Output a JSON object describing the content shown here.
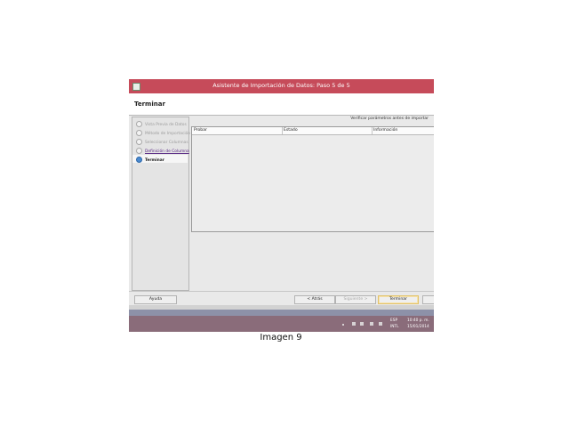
{
  "window": {
    "title": "Asistente de Importación de Datos: Paso 5 de 5"
  },
  "header": {
    "title": "Terminar"
  },
  "steps": [
    {
      "label": "Vista Previa de Datos",
      "state": "done"
    },
    {
      "label": "Método de Importación",
      "state": "done"
    },
    {
      "label": "Seleccionar Columnas",
      "state": "done"
    },
    {
      "label": "Definición de Columna",
      "state": "link"
    },
    {
      "label": "Terminar",
      "state": "current"
    }
  ],
  "main": {
    "verify_label": "Verificar parámetros antes de importar",
    "columns": [
      "Probar",
      "Estado",
      "Información"
    ]
  },
  "buttons": {
    "help": "Ayuda",
    "back": "< Atrás",
    "next": "Siguiente >",
    "finish": "Terminar"
  },
  "taskbar": {
    "lang_top": "ESP",
    "lang_bottom": "INTL",
    "time": "10:40 p. m.",
    "date": "15/01/2014"
  },
  "caption": "Imagen 9",
  "colors": {
    "titlebar": "#c64b5a",
    "taskbar": "#8a6c7a",
    "accent": "#5a2a85"
  }
}
